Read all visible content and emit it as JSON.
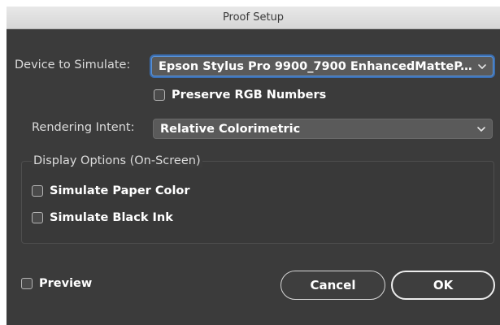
{
  "window": {
    "title": "Proof Setup"
  },
  "device": {
    "label": "Device to Simulate:",
    "value": "Epson Stylus Pro 9900_7900 EnhancedMatteP..."
  },
  "preserve_rgb": {
    "label": "Preserve RGB Numbers",
    "checked": false
  },
  "rendering_intent": {
    "label": "Rendering Intent:",
    "value": "Relative Colorimetric"
  },
  "display_options": {
    "title": "Display Options (On-Screen)",
    "simulate_paper": {
      "label": "Simulate Paper Color",
      "checked": false
    },
    "simulate_black": {
      "label": "Simulate Black Ink",
      "checked": false
    }
  },
  "preview": {
    "label": "Preview",
    "checked": false
  },
  "buttons": {
    "cancel": "Cancel",
    "ok": "OK"
  },
  "colors": {
    "background": "#3b3b3b",
    "focus_ring": "#3c82dc"
  },
  "icons": {
    "select_chevron": "chevron-down-icon"
  }
}
